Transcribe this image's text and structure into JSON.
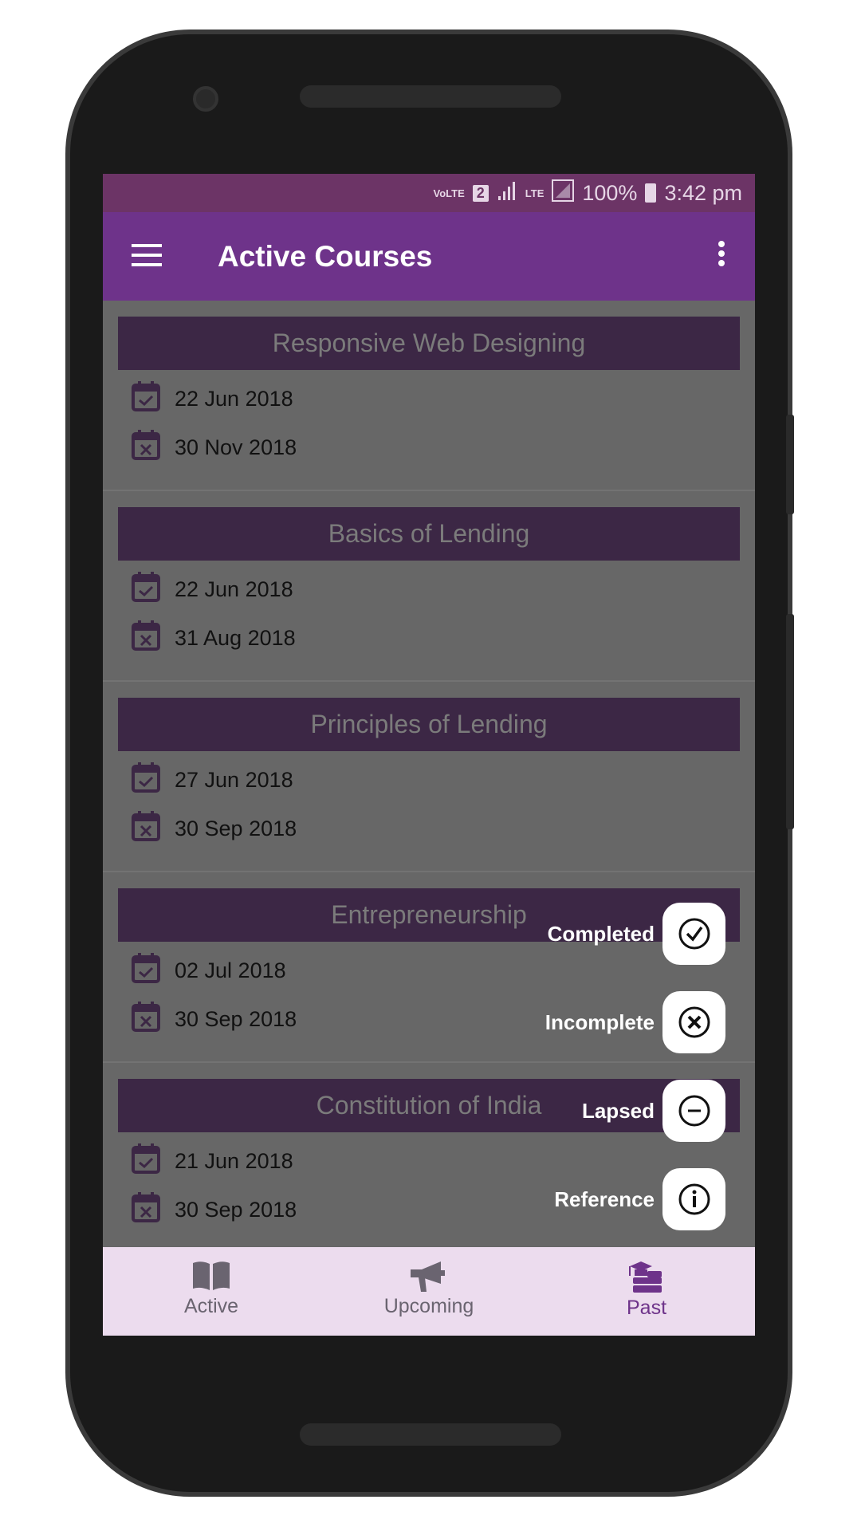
{
  "status_bar": {
    "network": "VoLTE",
    "sim": "2",
    "lte": "LTE",
    "battery": "100%",
    "time": "3:42 pm"
  },
  "app_bar": {
    "title": "Active Courses"
  },
  "courses": [
    {
      "name": "Responsive Web Designing",
      "start": "22 Jun 2018",
      "end": "30 Nov 2018"
    },
    {
      "name": "Basics of Lending",
      "start": "22 Jun 2018",
      "end": "31 Aug 2018"
    },
    {
      "name": "Principles of Lending",
      "start": "27 Jun 2018",
      "end": "30 Sep 2018"
    },
    {
      "name": "Entrepreneurship",
      "start": "02 Jul 2018",
      "end": "30 Sep 2018"
    },
    {
      "name": "Constitution of India",
      "start": "21 Jun 2018",
      "end": "30 Sep 2018"
    }
  ],
  "fab_menu": [
    {
      "label": "Completed",
      "icon": "check-circle-icon"
    },
    {
      "label": "Incomplete",
      "icon": "x-circle-icon"
    },
    {
      "label": "Lapsed",
      "icon": "minus-circle-icon"
    },
    {
      "label": "Reference",
      "icon": "info-circle-icon"
    }
  ],
  "bottom_nav": [
    {
      "label": "Active",
      "icon": "book-icon",
      "selected": false
    },
    {
      "label": "Upcoming",
      "icon": "megaphone-icon",
      "selected": false
    },
    {
      "label": "Past",
      "icon": "graduation-books-icon",
      "selected": true
    }
  ],
  "colors": {
    "accent": "#6e338a",
    "status_bar": "#6c3466",
    "nav_bg": "#ecdcee",
    "selected": "#6e338a"
  }
}
